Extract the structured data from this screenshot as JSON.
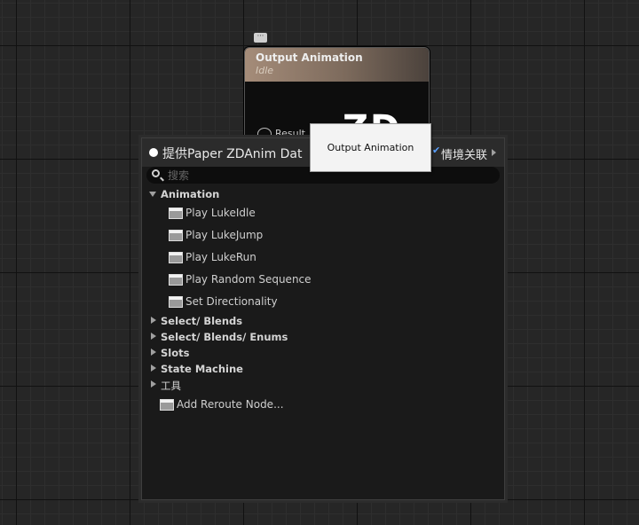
{
  "graph": {
    "comment_icon": "comment-bubble-icon",
    "node": {
      "title": "Output Animation",
      "subtitle": "Idle",
      "pin_label": "Result",
      "logo_text": "ZD"
    }
  },
  "tooltip": {
    "text": "Output Animation"
  },
  "menu": {
    "title": "提供Paper ZDAnim Dat",
    "context_label": "情境关联",
    "context_checked": true,
    "search_placeholder": "搜索",
    "search_value": "",
    "categories": [
      {
        "label": "Animation",
        "expanded": true,
        "items": [
          {
            "label": "Play LukeIdle"
          },
          {
            "label": "Play LukeJump"
          },
          {
            "label": "Play LukeRun"
          },
          {
            "label": "Play Random Sequence"
          },
          {
            "label": "Set Directionality"
          }
        ]
      },
      {
        "label": "Select/ Blends",
        "expanded": false
      },
      {
        "label": "Select/ Blends/ Enums",
        "expanded": false
      },
      {
        "label": "Slots",
        "expanded": false
      },
      {
        "label": "State Machine",
        "expanded": false
      },
      {
        "label": "工具",
        "expanded": false
      }
    ],
    "reroute_label": "Add Reroute Node..."
  },
  "colors": {
    "graph_background": "#262626",
    "node_header": "#a58c79",
    "menu_background": "#1a1a1a",
    "context_check": "#5aa0ff"
  }
}
